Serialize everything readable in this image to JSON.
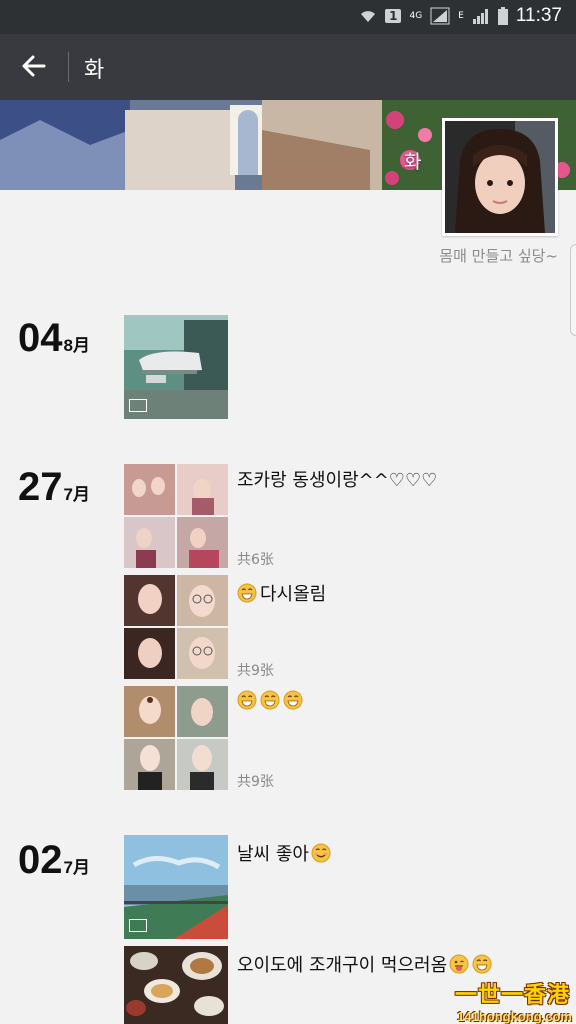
{
  "status_bar": {
    "time": "11:37",
    "network": "4G",
    "sim": "1",
    "e": "E"
  },
  "header": {
    "title": "화"
  },
  "profile": {
    "name": "화",
    "signature": "몸매 만들고 싶당~"
  },
  "posts": [
    {
      "day": "04",
      "month": "8月"
    },
    {
      "day": "27",
      "month": "7月",
      "text": "조카랑 동생이랑^^♡♡♡",
      "count": "共6张"
    },
    {
      "text": "다시올림",
      "count": "共9张"
    },
    {
      "count": "共9张"
    },
    {
      "day": "02",
      "month": "7月",
      "text": "날씨 좋아"
    },
    {
      "text": "오이도에 조개구이 먹으러옴"
    }
  ],
  "watermark": {
    "line1": "一世一香港",
    "line2": "141hongkong.com"
  },
  "colors": {
    "status_bg": "#2d3133",
    "appbar_bg": "#393a3f",
    "page_bg": "#f2f2f2"
  }
}
